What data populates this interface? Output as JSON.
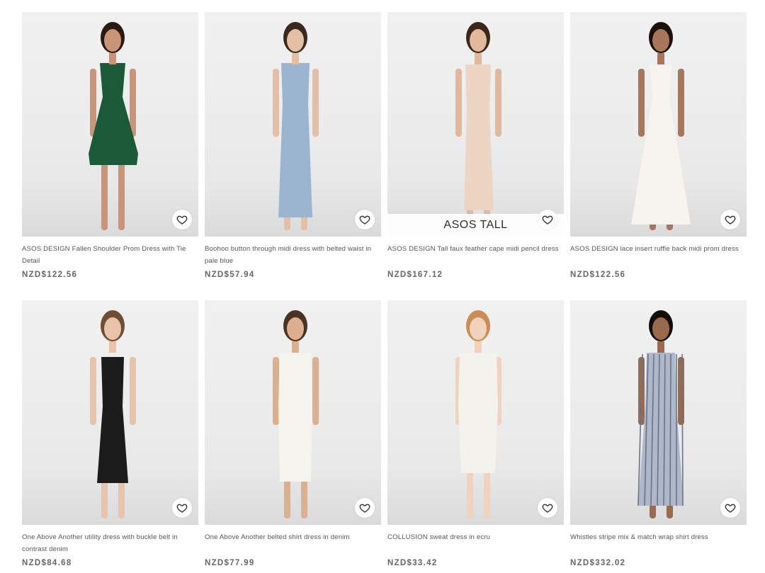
{
  "products": [
    {
      "title": "ASOS DESIGN Fallen Shoulder Prom Dress with Tie Detail",
      "price": "NZD$122.56",
      "dress_color": "#1a5a38",
      "skin": "#c99477",
      "hair": "#2a1a12",
      "style": "prom"
    },
    {
      "title": "Boohoo button through midi dress with belted waist in pale blue",
      "price": "NZD$57.94",
      "dress_color": "#9bb4cf",
      "skin": "#e4bfa5",
      "hair": "#3a2a1d",
      "style": "midi"
    },
    {
      "title": "ASOS DESIGN Tall faux feather cape midi pencil dress",
      "price": "NZD$167.12",
      "dress_color": "#ecd6c3",
      "skin": "#e2b89c",
      "hair": "#3c2619",
      "style": "pencil",
      "banner": "ASOS TALL"
    },
    {
      "title": "ASOS DESIGN lace insert ruffle back midi prom dress",
      "price": "NZD$122.56",
      "dress_color": "#f7f4ef",
      "skin": "#a8765a",
      "hair": "#1a110b",
      "style": "whitemidi"
    },
    {
      "title": "One Above Another utility dress with buckle belt in contrast denim",
      "price": "NZD$84.68",
      "dress_color": "#1b1b1b",
      "skin": "#e8c2a9",
      "hair": "#6e4f34",
      "style": "mini"
    },
    {
      "title": "One Above Another belted shirt dress in denim",
      "price": "NZD$77.99",
      "dress_color": "#f6f4ef",
      "skin": "#dcb08f",
      "hair": "#4a3322",
      "style": "shirt"
    },
    {
      "title": "COLLUSION sweat dress in ecru",
      "price": "NZD$33.42",
      "dress_color": "#f4f2ed",
      "skin": "#f0d2bd",
      "hair": "#c98d55",
      "style": "sweat"
    },
    {
      "title": "Whistles stripe mix & match wrap shirt dress",
      "price": "NZD$332.02",
      "dress_color": "#aeb8c8",
      "skin": "#9a6a4e",
      "hair": "#140d09",
      "style": "stripe"
    }
  ]
}
